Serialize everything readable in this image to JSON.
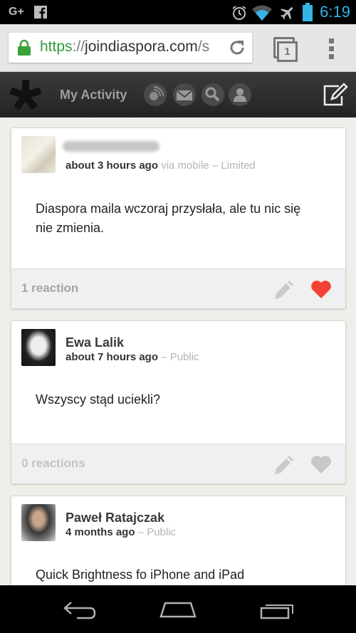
{
  "status_bar": {
    "left_icons": [
      "google-plus-icon",
      "facebook-icon"
    ],
    "gplus_text": "G+",
    "right_icons": [
      "alarm-icon",
      "wifi-icon",
      "airplane-icon",
      "battery-icon"
    ],
    "time": "6:19"
  },
  "browser": {
    "url_scheme": "https",
    "url_separator": "://",
    "url_host": "joindiaspora.com",
    "url_rest": "/s",
    "tab_count": "1"
  },
  "app_bar": {
    "title": "My Activity"
  },
  "posts": [
    {
      "author": "",
      "time": "about 3 hours ago",
      "via": "via mobile",
      "dash": " – ",
      "visibility": "Limited",
      "body": "Diaspora maila wczoraj przysłała, ale tu nic się nie zmienia.",
      "reactions": "1 reaction",
      "liked": true
    },
    {
      "author": "Ewa Lalik",
      "time": "about 7 hours ago",
      "via": "",
      "dash": " – ",
      "visibility": "Public",
      "body": "Wszyscy stąd uciekli?",
      "reactions": "0 reactions",
      "liked": false
    },
    {
      "author": "Paweł Ratajczak",
      "time": "4 months ago",
      "via": "",
      "dash": " – ",
      "visibility": "Public",
      "body": "Quick Brightness fo iPhone and iPad",
      "reactions": "",
      "liked": false
    }
  ],
  "colors": {
    "status_clock": "#33b5e5",
    "url_secure": "#2e9e3e",
    "heart_liked": "#f44336",
    "heart_unliked": "#bdbdbd"
  }
}
